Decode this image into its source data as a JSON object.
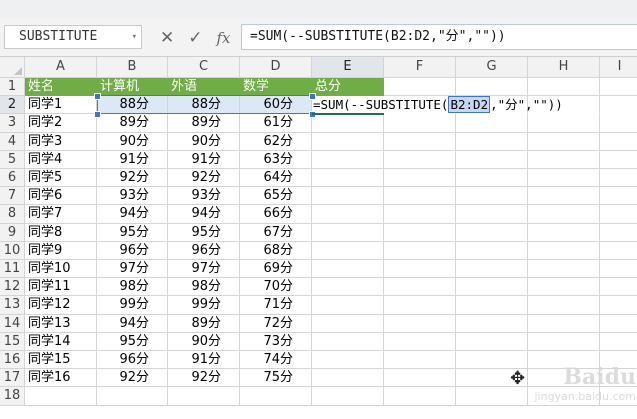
{
  "name_box": {
    "value": "SUBSTITUTE"
  },
  "formula_bar": {
    "cancel_glyph": "✕",
    "confirm_glyph": "✓",
    "fx_label": "fx",
    "formula": "=SUM(--SUBSTITUTE(B2:D2,\"分\",\"\"))"
  },
  "columns": [
    "A",
    "B",
    "C",
    "D",
    "E",
    "F",
    "G",
    "H",
    "I"
  ],
  "row_numbers": [
    "1",
    "2",
    "3",
    "4",
    "5",
    "6",
    "7",
    "8",
    "9",
    "10",
    "11",
    "12",
    "13",
    "14",
    "15",
    "16",
    "17",
    "18"
  ],
  "headers": {
    "name": "姓名",
    "computer": "计算机",
    "language": "外语",
    "math": "数学",
    "total": "总分"
  },
  "rows": [
    {
      "name": "同学1",
      "b": "88分",
      "c": "88分",
      "d": "60分"
    },
    {
      "name": "同学2",
      "b": "89分",
      "c": "89分",
      "d": "61分"
    },
    {
      "name": "同学3",
      "b": "90分",
      "c": "90分",
      "d": "62分"
    },
    {
      "name": "同学4",
      "b": "91分",
      "c": "91分",
      "d": "63分"
    },
    {
      "name": "同学5",
      "b": "92分",
      "c": "92分",
      "d": "64分"
    },
    {
      "name": "同学6",
      "b": "93分",
      "c": "93分",
      "d": "65分"
    },
    {
      "name": "同学7",
      "b": "94分",
      "c": "94分",
      "d": "66分"
    },
    {
      "name": "同学8",
      "b": "95分",
      "c": "95分",
      "d": "67分"
    },
    {
      "name": "同学9",
      "b": "96分",
      "c": "96分",
      "d": "68分"
    },
    {
      "name": "同学10",
      "b": "97分",
      "c": "97分",
      "d": "69分"
    },
    {
      "name": "同学11",
      "b": "98分",
      "c": "98分",
      "d": "70分"
    },
    {
      "name": "同学12",
      "b": "99分",
      "c": "99分",
      "d": "71分"
    },
    {
      "name": "同学13",
      "b": "94分",
      "c": "89分",
      "d": "72分"
    },
    {
      "name": "同学14",
      "b": "95分",
      "c": "90分",
      "d": "73分"
    },
    {
      "name": "同学15",
      "b": "96分",
      "c": "91分",
      "d": "74分"
    },
    {
      "name": "同学16",
      "b": "92分",
      "c": "92分",
      "d": "75分"
    }
  ],
  "edit_cell": {
    "prefix": "=SUM(--SUBSTITUTE(",
    "ref": "B2:D2",
    "suffix": ",\"分\",\"\"))"
  },
  "watermark": {
    "main": "Baidu",
    "sub": "jingyan.baidu.com"
  },
  "colors": {
    "header_green": "#70ad47",
    "selection_blue": "#4472c4",
    "selected_fill": "#dde8f7"
  }
}
